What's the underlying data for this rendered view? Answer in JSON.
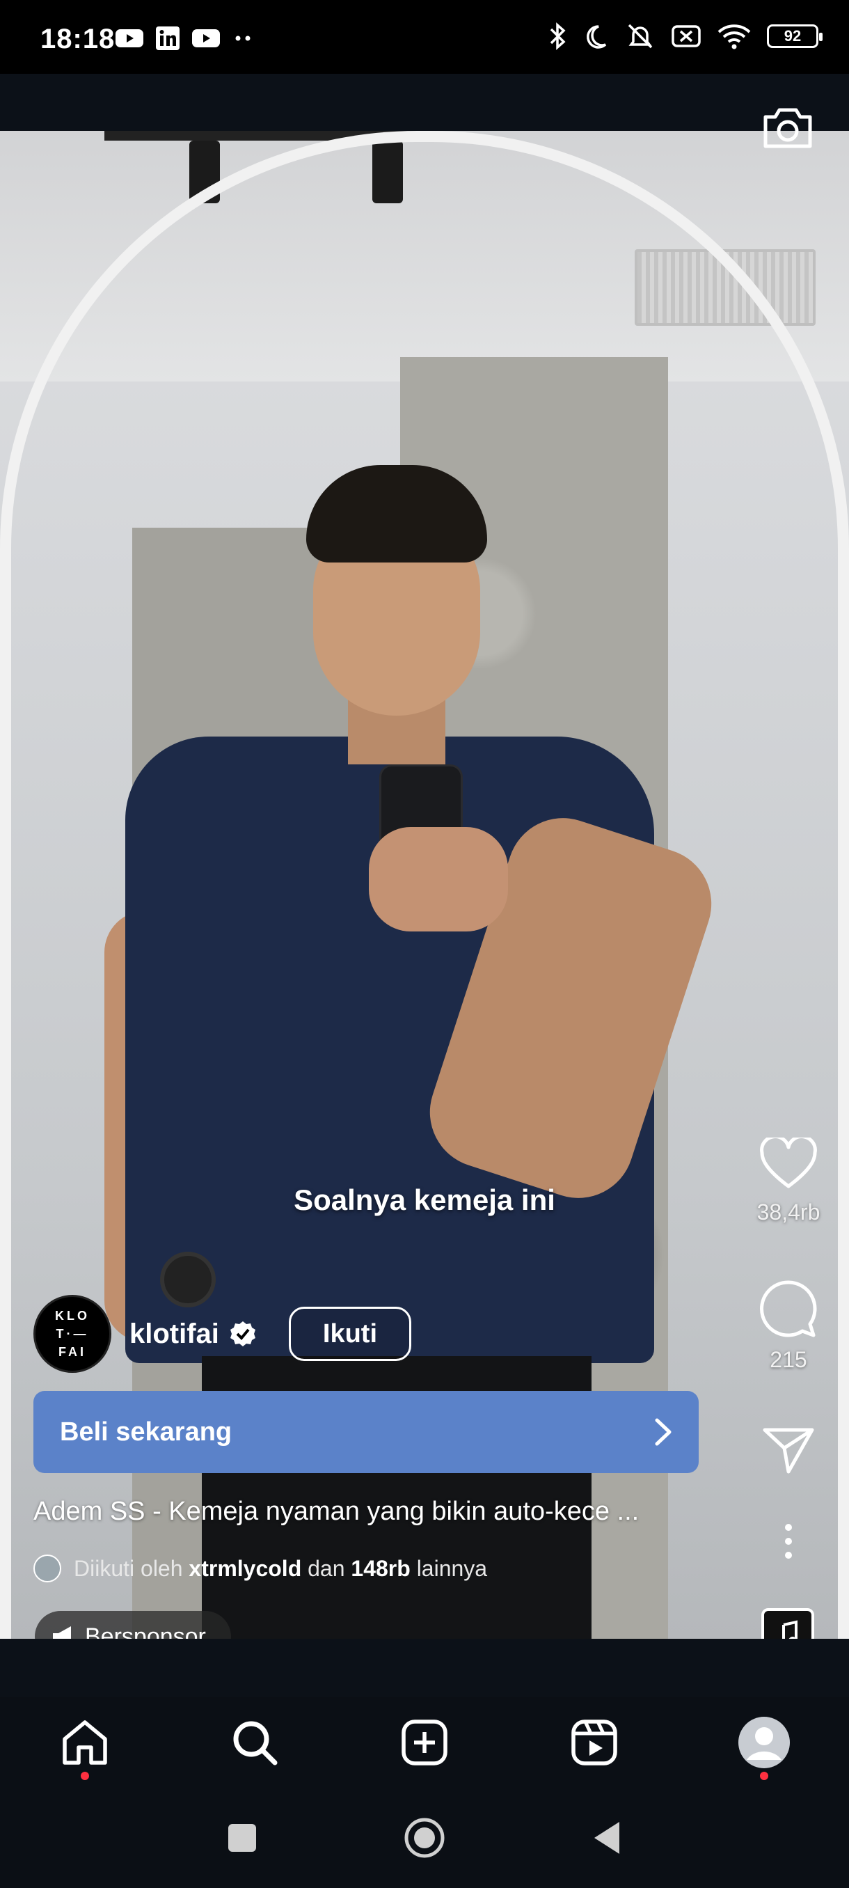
{
  "status_bar": {
    "time": "18:18",
    "battery": "92",
    "left_icons": [
      "youtube-icon",
      "linkedin-icon",
      "youtube-icon",
      "more-dots-icon"
    ],
    "right_icons": [
      "bluetooth-icon",
      "moon-icon",
      "silent-icon",
      "no-sim-icon",
      "wifi-icon",
      "battery-icon"
    ]
  },
  "video": {
    "caption": "Soalnya kemeja ini"
  },
  "rail": {
    "likes": "38,4rb",
    "comments": "215"
  },
  "account": {
    "avatar_lines": [
      "KLO",
      "T·—",
      "FAI"
    ],
    "username": "klotifai",
    "follow_label": "Ikuti"
  },
  "cta": {
    "label": "Beli sekarang"
  },
  "description": "Adem SS - Kemeja nyaman yang bikin auto-kece ...",
  "followed_by": {
    "prefix": "Diikuti oleh",
    "user": "xtrmlycold",
    "middle": "dan",
    "count": "148rb",
    "suffix": "lainnya"
  },
  "sponsor": {
    "label": "Bersponsor"
  },
  "colors": {
    "cta_bg": "#5b82c9",
    "notification_dot": "#ff3040",
    "nav_bg": "#0b0f15"
  }
}
